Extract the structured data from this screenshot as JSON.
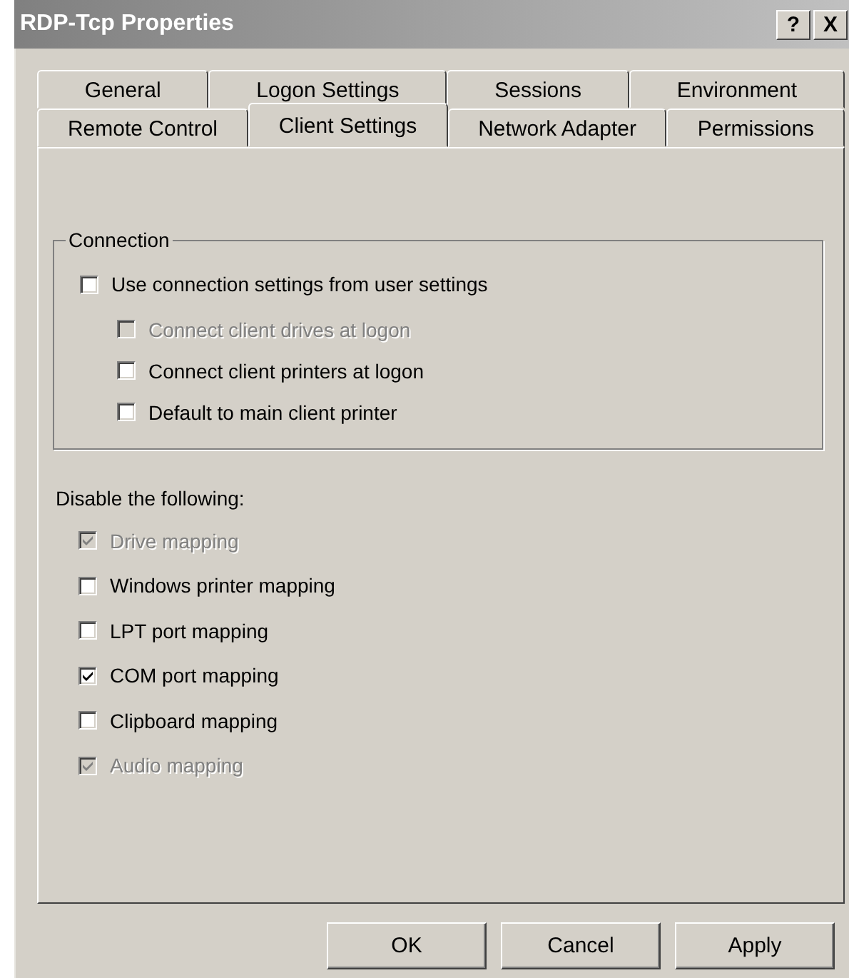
{
  "window": {
    "title": "RDP-Tcp Properties",
    "title_buttons": [
      "?",
      "X"
    ]
  },
  "tab_rows": [
    [
      {
        "label": "General",
        "selected": false
      },
      {
        "label": "Logon Settings",
        "selected": false
      },
      {
        "label": "Sessions",
        "selected": false
      },
      {
        "label": "Environment",
        "selected": false
      }
    ],
    [
      {
        "label": "Remote Control",
        "selected": false
      },
      {
        "label": "Client Settings",
        "selected": true
      },
      {
        "label": "Network Adapter",
        "selected": false
      },
      {
        "label": "Permissions",
        "selected": false
      }
    ]
  ],
  "connection": {
    "label": "Connection",
    "items": [
      {
        "label": "Use connection settings from user settings",
        "checked": false,
        "disabled": false,
        "children": [
          {
            "label": "Connect client drives at logon",
            "checked": false,
            "disabled": true
          },
          {
            "label": "Connect client printers at logon",
            "checked": false,
            "disabled": false
          },
          {
            "label": "Default to main client printer",
            "checked": false,
            "disabled": false
          }
        ]
      }
    ]
  },
  "disable": {
    "label": "Disable the following:",
    "items": [
      {
        "label": "Drive mapping",
        "checked": true,
        "disabled": true
      },
      {
        "label": "Windows printer mapping",
        "checked": false,
        "disabled": false
      },
      {
        "label": "LPT port mapping",
        "checked": false,
        "disabled": false
      },
      {
        "label": "COM port mapping",
        "checked": true,
        "disabled": false
      },
      {
        "label": "Clipboard mapping",
        "checked": false,
        "disabled": false
      },
      {
        "label": "Audio mapping",
        "checked": true,
        "disabled": true
      }
    ]
  },
  "buttons": [
    "OK",
    "Cancel",
    "Apply"
  ]
}
